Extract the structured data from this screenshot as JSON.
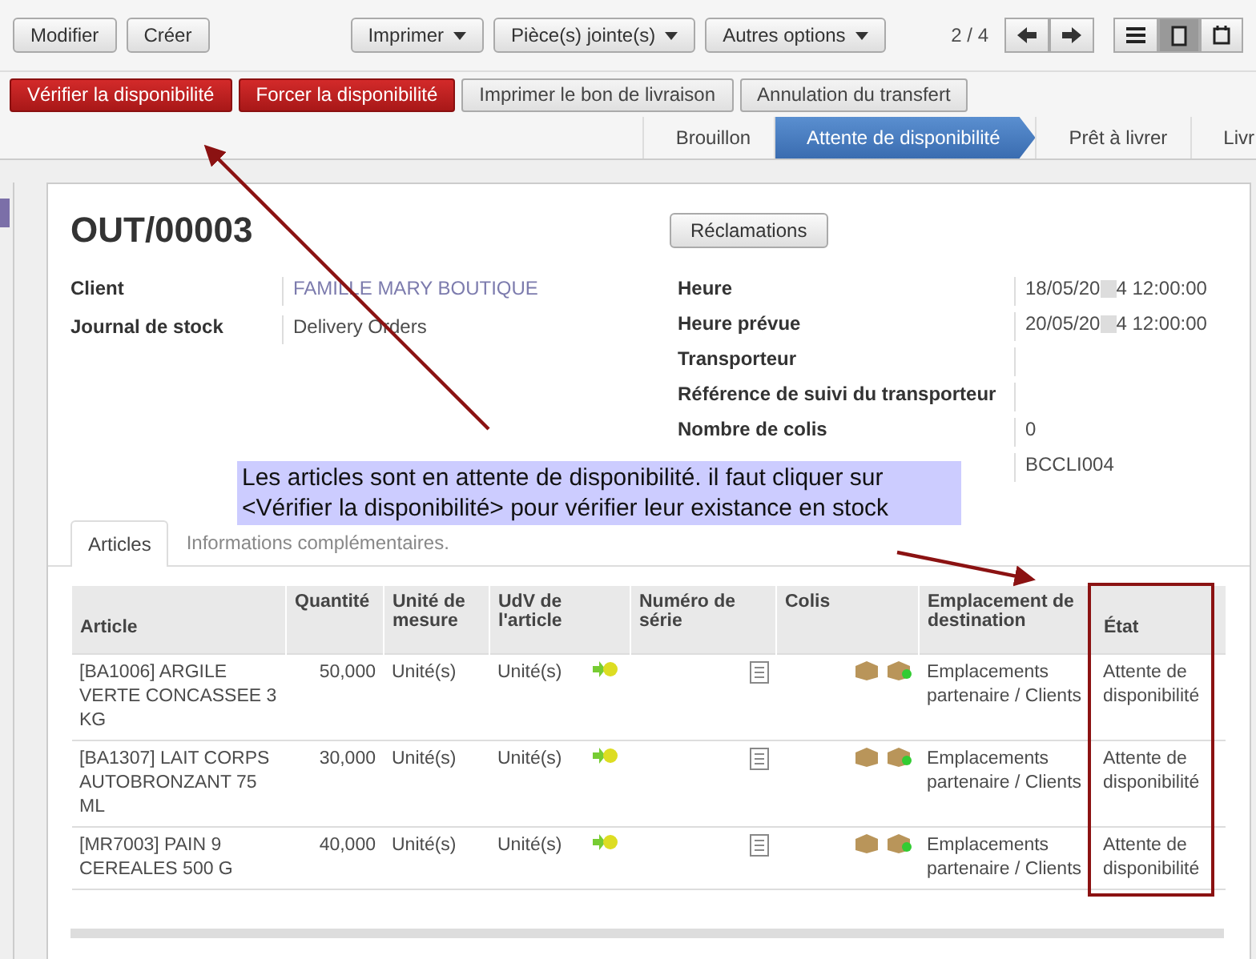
{
  "toolbar": {
    "left_buttons": [
      "Modifier",
      "Créer"
    ],
    "menus": [
      "Imprimer",
      "Pièce(s) jointe(s)",
      "Autres options"
    ],
    "pager": "2 / 4",
    "views": [
      {
        "kind": "list",
        "selected": false
      },
      {
        "kind": "form",
        "selected": true
      },
      {
        "kind": "calendar",
        "selected": false
      }
    ]
  },
  "actions": [
    {
      "label": "Vérifier la disponibilité",
      "primary": true
    },
    {
      "label": "Forcer la disponibilité",
      "primary": true
    },
    {
      "label": "Imprimer le bon de livraison",
      "primary": false
    },
    {
      "label": "Annulation du transfert",
      "primary": false
    }
  ],
  "stages": [
    {
      "label": "Brouillon",
      "selected": false
    },
    {
      "label": "Attente de disponibilité",
      "selected": true
    },
    {
      "label": "Prêt à livrer",
      "selected": false
    },
    {
      "label": "Livr",
      "selected": false
    }
  ],
  "record": {
    "title": "OUT/00003",
    "smart_button": "Réclamations",
    "left_fields": [
      {
        "label": "Client",
        "value": "FAMILLE MARY BOUTIQUE",
        "link": true
      },
      {
        "label": "Journal de stock",
        "value": "Delivery Orders",
        "link": false
      }
    ],
    "right_fields": [
      {
        "label": "Heure",
        "value": "18/05/20",
        "value_end": "4 12:00:00"
      },
      {
        "label": "Heure prévue",
        "value": "20/05/20",
        "value_end": "4 12:00:00"
      },
      {
        "label": "Transporteur"
      },
      {
        "label": "Référence de suivi du transporteur"
      },
      {
        "label": "Nombre de colis",
        "value": "0"
      },
      {
        "value": "BCCLI004"
      }
    ]
  },
  "note": "Les articles sont en attente de disponibilité. il faut cliquer sur <Vérifier la disponibilité> pour vérifier leur existance en stock",
  "tabs": [
    {
      "label": "Articles",
      "selected": true
    },
    {
      "label": "Informations complémentaires.",
      "selected": false
    }
  ],
  "table": {
    "columns": [
      "Article",
      "Quantité",
      "Unité de mesure",
      "UdV de l'article",
      "Numéro de série",
      "Colis",
      "Emplacement de destination",
      "État"
    ],
    "rows": [
      {
        "article": "[BA1006] ARGILE VERTE CONCASSEE 3 KG",
        "quantity": "50,000",
        "uom": "Unité(s)",
        "uos": "Unité(s)",
        "location": "Emplacements partenaire / Clients",
        "state": "Attente de disponibilité"
      },
      {
        "article": "[BA1307] LAIT CORPS AUTOBRONZANT 75 ML",
        "quantity": "30,000",
        "uom": "Unité(s)",
        "uos": "Unité(s)",
        "location": "Emplacements partenaire / Clients",
        "state": "Attente de disponibilité"
      },
      {
        "article": "[MR7003] PAIN 9 CEREALES 500 G",
        "quantity": "40,000",
        "uom": "Unité(s)",
        "uos": "Unité(s)",
        "location": "Emplacements partenaire / Clients",
        "state": "Attente de disponibilité"
      }
    ]
  }
}
